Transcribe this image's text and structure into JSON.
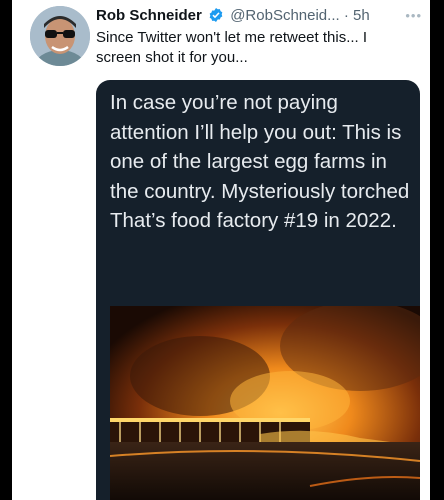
{
  "tweet": {
    "author": "Rob Schneider",
    "handle": "@RobSchneid...",
    "separator": "·",
    "time": "5h",
    "more_icon": "more-dots-icon",
    "text": "Since Twitter won't let me retweet this... I screen shot it for you...",
    "quoted_image_text": "In case you’re not paying attention I’ll help you out: This is one of the largest egg farms in the country. Mysteriously torched That’s food factory #19 in 2022."
  },
  "colors": {
    "verified": "#1d9bf0",
    "inner_bg": "#15202b",
    "inner_text": "#e7ebef",
    "secondary_text": "#536471"
  }
}
